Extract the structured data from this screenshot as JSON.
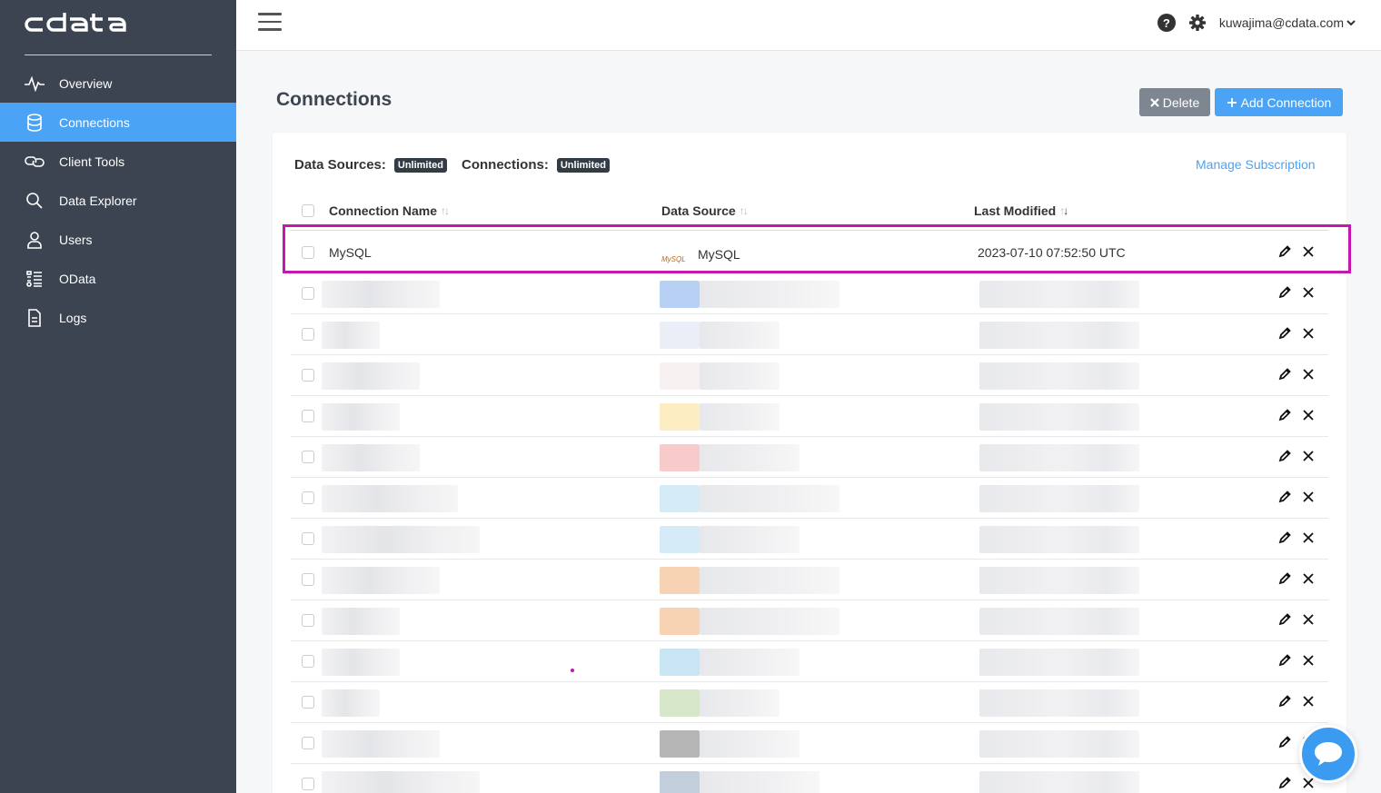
{
  "brand": {
    "logo_text": "cdata"
  },
  "sidebar": {
    "items": [
      {
        "label": "Overview",
        "icon": "activity-icon",
        "active": false
      },
      {
        "label": "Connections",
        "icon": "database-icon",
        "active": true
      },
      {
        "label": "Client Tools",
        "icon": "link-icon",
        "active": false
      },
      {
        "label": "Data Explorer",
        "icon": "search-icon",
        "active": false
      },
      {
        "label": "Users",
        "icon": "user-icon",
        "active": false
      },
      {
        "label": "OData",
        "icon": "odata-icon",
        "active": false
      },
      {
        "label": "Logs",
        "icon": "document-icon",
        "active": false
      }
    ]
  },
  "topbar": {
    "user_email": "kuwajima@cdata.com",
    "help_glyph": "?"
  },
  "page": {
    "title": "Connections",
    "delete_label": "Delete",
    "add_label": "Add Connection"
  },
  "limits": {
    "data_sources_label": "Data Sources:",
    "data_sources_value": "Unlimited",
    "connections_label": "Connections:",
    "connections_value": "Unlimited",
    "manage_link": "Manage Subscription"
  },
  "table": {
    "columns": [
      "Connection Name",
      "Data Source",
      "Last Modified"
    ],
    "rows": [
      {
        "name": "MySQL",
        "data_source": "MySQL",
        "data_source_logo": "MySQL",
        "last_modified": "2023-07-10 07:52:50 UTC"
      }
    ],
    "redacted_row_count": 13
  },
  "colors": {
    "sidebar_bg": "#3b4450",
    "accent": "#4aa3f5",
    "highlight": "#c218b0",
    "delete_btn": "#7e8791"
  }
}
